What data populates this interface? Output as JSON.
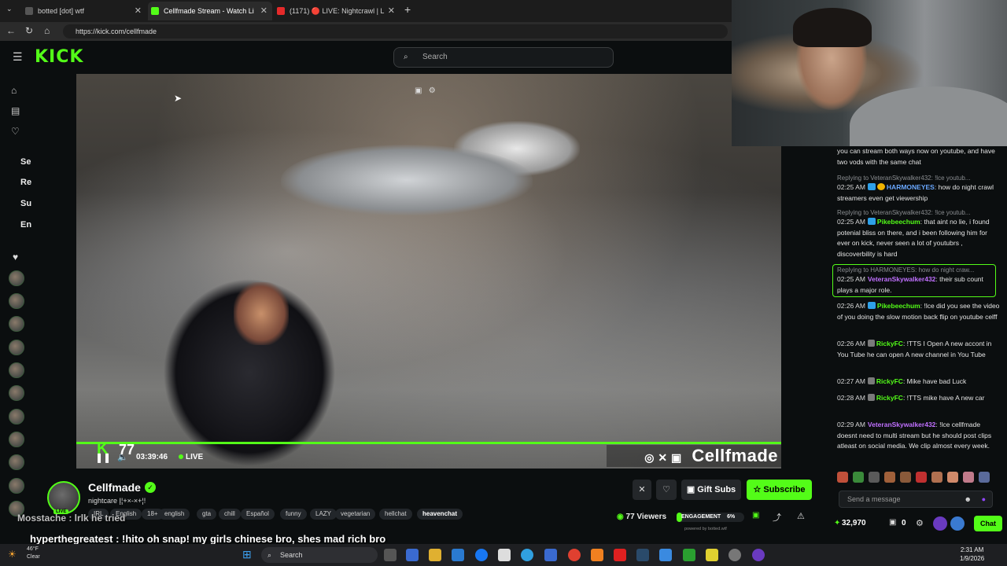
{
  "browser": {
    "tabs": [
      {
        "title": "botted [dot] wtf",
        "active": false
      },
      {
        "title": "Cellfmade Stream - Watch Li",
        "active": true
      },
      {
        "title": "(1171) 🔴 LIVE: Nightcrawl | L",
        "active": false
      }
    ],
    "url": "https://kick.com/cellfmade"
  },
  "header": {
    "logo": "KICK",
    "search_placeholder": "Search"
  },
  "sidebar": {
    "collapsed_labels": [
      "Se",
      "Re",
      "Su",
      "En"
    ]
  },
  "video": {
    "elapsed": "03:39:46",
    "live_label": "LIVE",
    "overlay_viewer_count": "77",
    "overlay_brand": "Cellfmade"
  },
  "channel": {
    "name": "Cellfmade",
    "title": "nightcare Į¦+×-×+¦!",
    "live_badge": "LIVE",
    "tags": [
      "IRL",
      "English",
      "18+",
      "english",
      "gta",
      "chill",
      "Español",
      "funny",
      "LAZY",
      "vegetarian",
      "hellchat",
      "heavenchat"
    ],
    "viewers": "77 Viewers",
    "engagement_label": "ENGAGEMENT",
    "engagement_value": "6%",
    "engagement_fraction": 0.06,
    "powered_by": "powered by botted.wtf",
    "gift_label": "Gift Subs",
    "subscribe_label": "Subscribe"
  },
  "overlay_chat": [
    {
      "user": "Mosstache",
      "text": "Mosstache : lrlk he tried"
    },
    {
      "user": "hyperthegreatest",
      "text": "hyperthegreatest : !hito oh snap! my girls chinese bro, shes mad rich bro"
    }
  ],
  "chat": {
    "messages": [
      {
        "text": "you can stream both ways now on youtube, and have two vods with the same chat"
      },
      {
        "reply": "Replying to VeteranSkywalker432: !lce youtub..."
      },
      {
        "time": "02:25 AM",
        "user": "HARMONEYES",
        "user_color": "#6aa8ff",
        "text": "how do night crawl streamers even get viewership"
      },
      {
        "reply": "Replying to VeteranSkywalker432: !lce youtub..."
      },
      {
        "time": "02:25 AM",
        "user": "Pikebeechum",
        "user_color": "#53fc18",
        "text": "that aint no lie, i found potenial bliss on there, and i been following him for ever on kick, never seen a lot of youtubrs , discoverbility is hard"
      },
      {
        "reply": "Replying to HARMONEYES: how do night craw..."
      },
      {
        "time": "02:25 AM",
        "user": "VeteranSkywalker432",
        "user_color": "#c070ff",
        "text": "their sub count plays a major role."
      },
      {
        "time": "02:26 AM",
        "user": "Pikebeechum",
        "user_color": "#53fc18",
        "text": "!lce did you see the video of you doing the slow motion back flip on youtube celff"
      },
      {
        "time": "02:26 AM",
        "user": "RickyFC",
        "user_color": "#53fc18",
        "text": "!TTS I Open A new accont in You Tube he can open A new channel in You Tube"
      },
      {
        "time": "02:27 AM",
        "user": "RickyFC",
        "user_color": "#53fc18",
        "text": "Mike have bad Luck"
      },
      {
        "time": "02:28 AM",
        "user": "RickyFC",
        "user_color": "#53fc18",
        "text": "!TTS mike have A new car"
      },
      {
        "time": "02:29 AM",
        "user": "VeteranSkywalker432",
        "user_color": "#c070ff",
        "text": "!lce cellfmade doesnt need to multi stream but he should post clips atleast on social media. We clip almost every week."
      }
    ],
    "input_placeholder": "Send a message",
    "points": "32,970",
    "redeem_count": "0",
    "chat_button": "Chat"
  },
  "taskbar": {
    "search": "Search",
    "weather_temp": "46°F",
    "weather_text": "Clear",
    "time": "2:31 AM",
    "date": "1/9/2026"
  },
  "colors": {
    "accent": "#53fc18",
    "background": "#0b0e0f"
  }
}
